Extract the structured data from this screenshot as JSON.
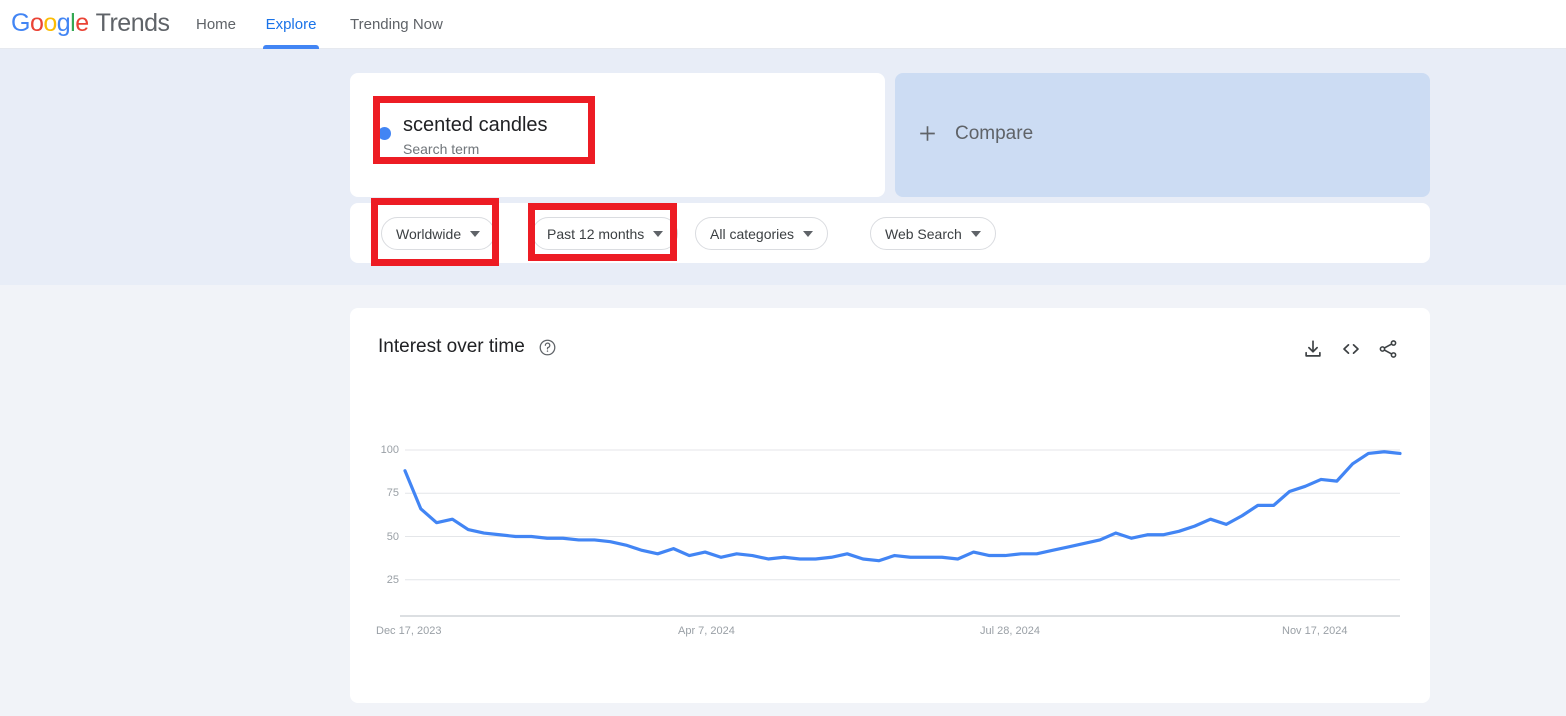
{
  "header": {
    "logo": {
      "google": "Google",
      "trends": "Trends"
    },
    "nav": [
      {
        "label": "Home",
        "active": false
      },
      {
        "label": "Explore",
        "active": true
      },
      {
        "label": "Trending Now",
        "active": false
      }
    ]
  },
  "query": {
    "term": "scented candles",
    "type_label": "Search term",
    "dot_color": "#4285f4"
  },
  "compare": {
    "label": "Compare",
    "icon": "plus-icon"
  },
  "filters": [
    {
      "id": "location",
      "label": "Worldwide"
    },
    {
      "id": "time",
      "label": "Past 12 months"
    },
    {
      "id": "category",
      "label": "All categories"
    },
    {
      "id": "search_type",
      "label": "Web Search"
    }
  ],
  "chart_card": {
    "title": "Interest over time",
    "help_icon": "question-circle-icon",
    "tools": [
      {
        "id": "download",
        "icon": "download-icon"
      },
      {
        "id": "embed",
        "icon": "code-embed-icon"
      },
      {
        "id": "share",
        "icon": "share-icon"
      }
    ]
  },
  "annotations": {
    "color": "#ed1c24",
    "boxes": [
      "search-term-card",
      "worldwide-filter",
      "past-12-months-filter"
    ]
  },
  "chart_data": {
    "type": "line",
    "title": "Interest over time",
    "xlabel": "",
    "ylabel": "",
    "ylim": [
      0,
      100
    ],
    "yticks": [
      25,
      50,
      75,
      100
    ],
    "ytick_labels": [
      "25",
      "50",
      "75",
      "100"
    ],
    "grid": true,
    "legend": false,
    "line_color": "#4285f4",
    "x_tick_labels": [
      "Dec 17, 2023",
      "Apr 7, 2024",
      "Jul 28, 2024",
      "Nov 17, 2024"
    ],
    "x_tick_positions": [
      0,
      16,
      32,
      48
    ],
    "series": [
      {
        "name": "scented candles",
        "values": [
          88,
          66,
          58,
          60,
          54,
          52,
          51,
          50,
          50,
          49,
          49,
          48,
          48,
          47,
          45,
          42,
          40,
          43,
          39,
          41,
          38,
          40,
          39,
          37,
          38,
          37,
          37,
          38,
          40,
          37,
          36,
          39,
          38,
          38,
          38,
          37,
          41,
          39,
          39,
          40,
          40,
          42,
          44,
          46,
          48,
          52,
          49,
          51,
          51,
          53,
          56,
          60,
          57,
          62,
          68,
          68,
          76,
          79,
          83,
          82,
          92,
          98,
          99,
          98
        ]
      }
    ]
  }
}
